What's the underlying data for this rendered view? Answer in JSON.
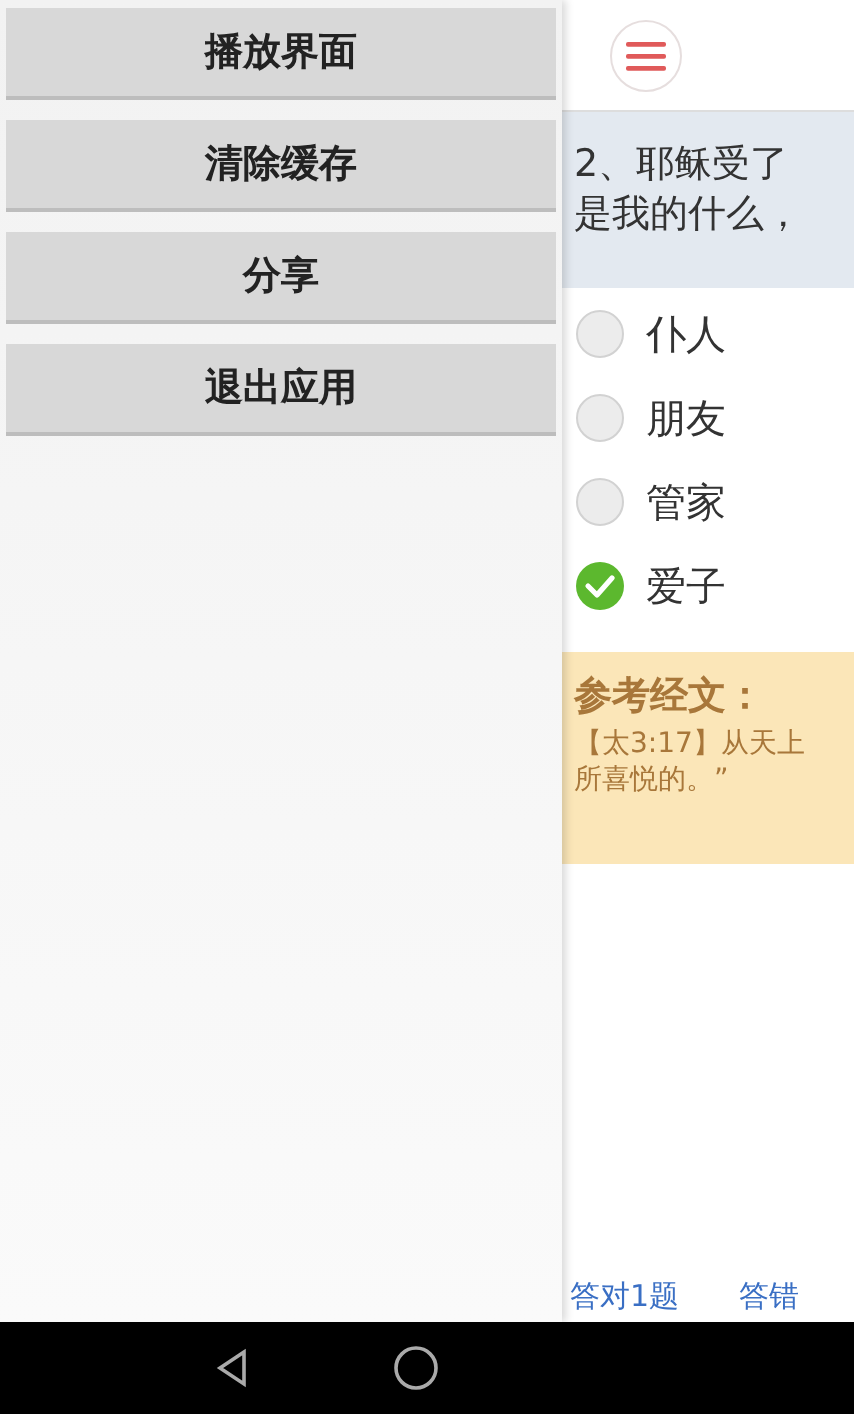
{
  "drawer": {
    "buttons": [
      "播放界面",
      "清除缓存",
      "分享",
      "退出应用"
    ]
  },
  "question": {
    "lines": [
      "2、耶稣受了",
      "是我的什么，"
    ]
  },
  "options": [
    {
      "label": "仆人",
      "selected": false
    },
    {
      "label": "朋友",
      "selected": false
    },
    {
      "label": "管家",
      "selected": false
    },
    {
      "label": "爱子",
      "selected": true
    }
  ],
  "reference": {
    "title": "参考经文：",
    "lines": [
      "【太3:17】从天上",
      "所喜悦的。”"
    ]
  },
  "footer": [
    "答对1题",
    "答错"
  ]
}
